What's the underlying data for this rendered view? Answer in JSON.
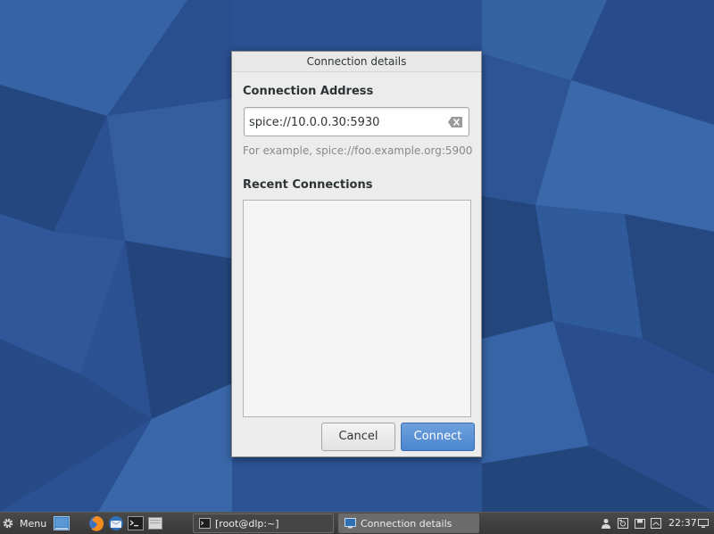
{
  "dialog": {
    "title": "Connection details",
    "address_heading": "Connection Address",
    "address_value": "spice://10.0.0.30:5930",
    "example_text": "For example, spice://foo.example.org:5900",
    "recent_heading": "Recent Connections",
    "recent_connections": [],
    "cancel_label": "Cancel",
    "connect_label": "Connect"
  },
  "taskbar": {
    "menu_label": "Menu",
    "launchers": [
      "desktop-icon",
      "firefox-icon",
      "thunderbird-icon",
      "terminal-icon",
      "files-icon"
    ],
    "tasks": [
      {
        "label": "[root@dlp:~]",
        "icon": "terminal-icon",
        "active": false
      },
      {
        "label": "Connection details",
        "icon": "remote-viewer-icon",
        "active": true
      }
    ],
    "tray_icons": [
      "user-icon",
      "screenshot-icon",
      "removable-media-icon",
      "notifications-icon",
      "network-icon",
      "display-icon"
    ],
    "clock": "22:37"
  },
  "colors": {
    "wallpaper": "#2b5193",
    "accent_button": "#4a86cf",
    "dialog_bg": "#ececec",
    "taskbar": "#3e3e3e"
  }
}
